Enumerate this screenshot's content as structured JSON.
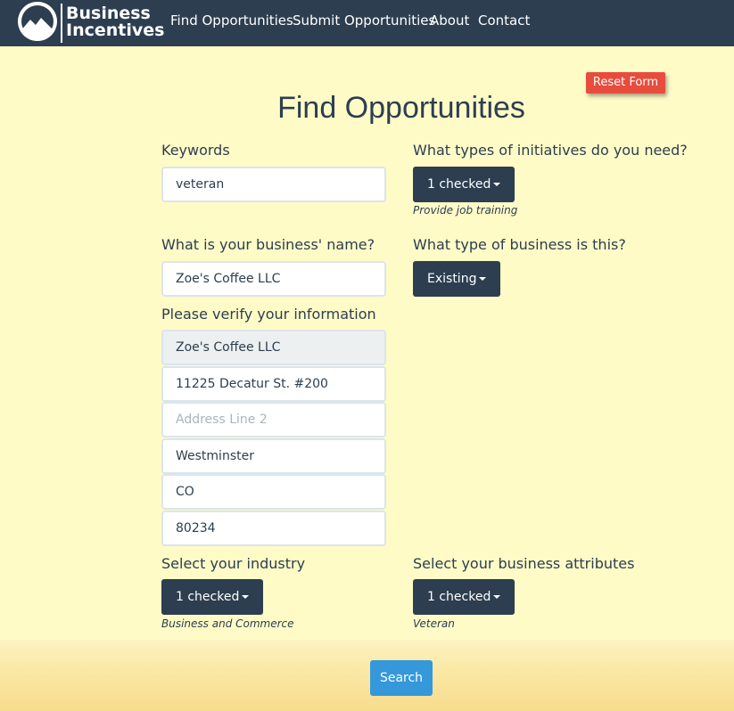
{
  "nav": {
    "logo_line1": "Business",
    "logo_line2": "Incentives",
    "links": [
      "Find Opportunities",
      "Submit Opportunities",
      "About",
      "Contact"
    ]
  },
  "reset_label": "Reset Form",
  "title": "Find Opportunities",
  "keywords": {
    "label": "Keywords",
    "value": "veteran"
  },
  "initiatives": {
    "label": "What types of initiatives do you need?",
    "button": "1 checked",
    "selected": "Provide job training"
  },
  "business_name": {
    "label": "What is your business' name?",
    "value": "Zoe's Coffee LLC"
  },
  "business_type": {
    "label": "What type of business is this?",
    "button": "Existing"
  },
  "verify": {
    "label": "Please verify your information",
    "name": "Zoe's Coffee LLC",
    "address1": "11225 Decatur St. #200",
    "address2_placeholder": "Address Line 2",
    "city": "Westminster",
    "state": "CO",
    "zip": "80234"
  },
  "industry": {
    "label": "Select your industry",
    "button": "1 checked",
    "selected": "Business and Commerce"
  },
  "attributes": {
    "label": "Select your business attributes",
    "button": "1 checked",
    "selected": "Veteran"
  },
  "search_label": "Search",
  "colors": {
    "navbar": "#2c3e50",
    "background": "#fefbc7",
    "danger": "#e74c3c",
    "primary": "#2c3e50",
    "info": "#3498db"
  }
}
